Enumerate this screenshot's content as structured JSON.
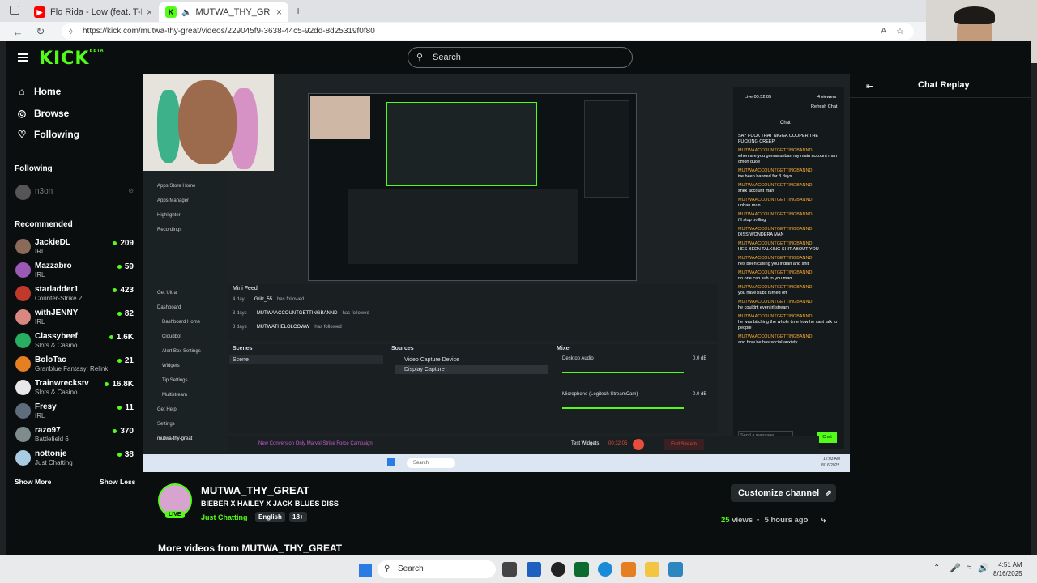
{
  "browser": {
    "tabs": [
      {
        "label": "Flo Rida - Low (feat. T-Pain) [from",
        "active": false
      },
      {
        "label": "MUTWA_THY_GREAT - Watc",
        "active": true
      }
    ],
    "url": "https://kick.com/mutwa-thy-great/videos/229045f9-3638-44c5-92dd-8d25319f0f80"
  },
  "header": {
    "logo": "KICK",
    "logo_badge": "BETA",
    "search_placeholder": "Search"
  },
  "sidebar": {
    "nav": [
      {
        "label": "Home",
        "icon": "home-icon"
      },
      {
        "label": "Browse",
        "icon": "compass-icon"
      },
      {
        "label": "Following",
        "icon": "heart-icon"
      }
    ],
    "following_header": "Following",
    "following": [
      {
        "name": "n3on"
      }
    ],
    "recommended_header": "Recommended",
    "recommended": [
      {
        "name": "JackieDL",
        "category": "IRL",
        "viewers": "209",
        "color": "#8b6a5a"
      },
      {
        "name": "Mazzabro",
        "category": "IRL",
        "viewers": "59",
        "color": "#9b59b6"
      },
      {
        "name": "starladder1",
        "category": "Counter-Strike 2",
        "viewers": "423",
        "color": "#c0392b"
      },
      {
        "name": "withJENNY",
        "category": "IRL",
        "viewers": "82",
        "color": "#d98880"
      },
      {
        "name": "Classybeef",
        "category": "Slots & Casino",
        "viewers": "1.6K",
        "color": "#27ae60"
      },
      {
        "name": "BoloTac",
        "category": "Granblue Fantasy: Relink",
        "viewers": "21",
        "color": "#e67e22"
      },
      {
        "name": "Trainwreckstv",
        "category": "Slots & Casino",
        "viewers": "16.8K",
        "color": "#e8e8e8"
      },
      {
        "name": "Fresy",
        "category": "IRL",
        "viewers": "11",
        "color": "#5d6d7e"
      },
      {
        "name": "razo97",
        "category": "Battlefield 6",
        "viewers": "370",
        "color": "#7f8c8d"
      },
      {
        "name": "nottonje",
        "category": "Just Chatting",
        "viewers": "38",
        "color": "#a9cce3"
      }
    ],
    "show_more": "Show More",
    "show_less": "Show Less"
  },
  "video": {
    "obs": {
      "left_menu": [
        "Apps Store Home",
        "Apps Manager",
        "Highlighter",
        "Recordings"
      ],
      "left_menu2": [
        "Get Ultra",
        "Dashboard",
        "Dashboard Home",
        "Cloudbot",
        "Alert Box Settings",
        "Widgets",
        "Tip Settings",
        "Multistream",
        "Get Help",
        "Settings"
      ],
      "user": "mutwa-thy-great",
      "mini_feed_title": "Mini Feed",
      "feed": [
        {
          "time": "4 day",
          "user": "Grilz_55",
          "action": "has followed"
        },
        {
          "time": "3 days",
          "user": "MUTWAACCOUNTGETTINGBANND",
          "action": "has followed"
        },
        {
          "time": "3 days",
          "user": "MUTWATHELOLCOWW",
          "action": "has followed"
        }
      ],
      "scenes_title": "Scenes",
      "scene": "Scene",
      "sources_title": "Sources",
      "sources": [
        "Video Capture Device",
        "Display Capture"
      ],
      "mixer_title": "Mixer",
      "mixer": [
        {
          "name": "Desktop Audio",
          "level": "0.0 dB"
        },
        {
          "name": "Microphone (Logitech StreamCam)",
          "level": "0.0 dB"
        }
      ],
      "campaign": "New Conversion Only Marvel Strike Force Campaign",
      "test_widgets": "Test Widgets",
      "timer": "00:32:05",
      "end_stream": "End Stream",
      "chat_live": "Live 00:52:05",
      "chat_viewers": "4 viewers",
      "chat_refresh": "Refresh Chat",
      "chat_title": "Chat",
      "chat_first": "SAY FUCK THAT NIGGA COOPER THE FUCKING CREEP",
      "chat_user": "MUTWAACCOUNTGETTINGBANND:",
      "chat_messages": [
        "when are you gonna unban my main account man cmon dude",
        "ive been banned for 3 days",
        "snkk account man",
        "unban man",
        "i'll stop trolling",
        "DISS WONDERA MAN",
        "HES BEEN TALKING SHIT ABOUT YOU",
        "hes been calling you indian and shit",
        "no one can sub to you man",
        "you have subs turned off",
        "he couldnt even irl stream",
        "he was bitching the whole time how he cant talk to people",
        "and how he has social anxiety"
      ],
      "send_placeholder": "Send a message",
      "chat_button": "Chat",
      "win_search": "Search",
      "win_time": "12:03 AM",
      "win_date": "8/16/2025"
    }
  },
  "channel": {
    "name": "MUTWA_THY_GREAT",
    "title": "BIEBER X HAILEY X JACK BLUES DISS",
    "category": "Just Chatting",
    "tags": [
      "English",
      "18+"
    ],
    "live_badge": "LIVE",
    "customize": "Customize channel",
    "views_count": "25",
    "views_label": "views",
    "age": "5 hours ago",
    "more_videos": "More videos from MUTWA_THY_GREAT"
  },
  "chat_replay": {
    "title": "Chat Replay"
  },
  "taskbar": {
    "search": "Search",
    "time": "4:51 AM",
    "date": "8/16/2025"
  },
  "colors": {
    "accent": "#53fc18",
    "bg": "#0b0e0f"
  }
}
